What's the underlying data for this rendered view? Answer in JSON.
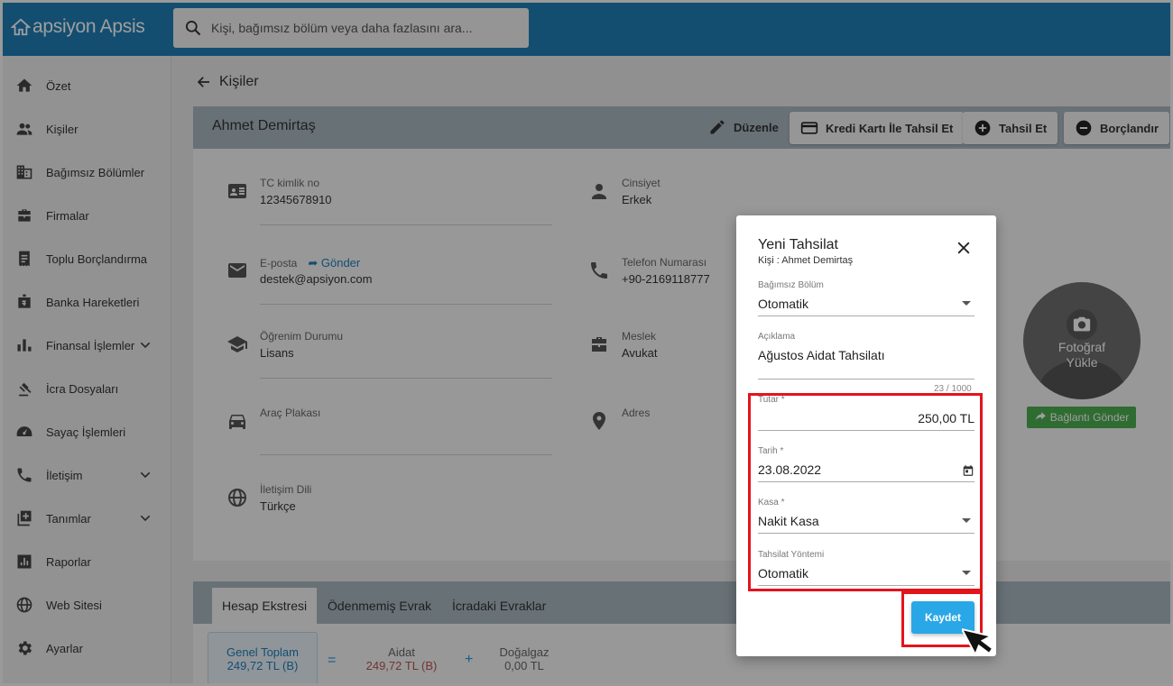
{
  "app": {
    "name": "apsiyon Apsis"
  },
  "search": {
    "placeholder": "Kişi, bağımsız bölüm veya daha fazlasını ara..."
  },
  "sidebar": {
    "items": [
      {
        "label": "Özet",
        "icon": "home-icon"
      },
      {
        "label": "Kişiler",
        "icon": "people-icon"
      },
      {
        "label": "Bağımsız Bölümler",
        "icon": "building-icon"
      },
      {
        "label": "Firmalar",
        "icon": "briefcase-icon"
      },
      {
        "label": "Toplu Borçlandırma",
        "icon": "receipt-icon"
      },
      {
        "label": "Banka Hareketleri",
        "icon": "bank-icon"
      },
      {
        "label": "Finansal İşlemler",
        "icon": "bar-chart-icon",
        "expandable": true
      },
      {
        "label": "İcra Dosyaları",
        "icon": "gavel-icon"
      },
      {
        "label": "Sayaç İşlemleri",
        "icon": "meter-icon"
      },
      {
        "label": "İletişim",
        "icon": "phone-icon",
        "expandable": true
      },
      {
        "label": "Tanımlar",
        "icon": "add-box-icon",
        "expandable": true
      },
      {
        "label": "Raporlar",
        "icon": "report-icon"
      },
      {
        "label": "Web Sitesi",
        "icon": "globe-icon"
      },
      {
        "label": "Ayarlar",
        "icon": "gear-icon"
      }
    ]
  },
  "page": {
    "back_label": "Kişiler"
  },
  "person": {
    "name": "Ahmet Demirtaş",
    "edit_label": "Düzenle",
    "actions": {
      "credit_card": "Kredi Kartı İle Tahsil Et",
      "collect": "Tahsil Et",
      "debit": "Borçlandır"
    },
    "fields": {
      "tc": {
        "label": "TC kimlik no",
        "value": "12345678910"
      },
      "gender": {
        "label": "Cinsiyet",
        "value": "Erkek"
      },
      "email": {
        "label": "E-posta",
        "send": "Gönder",
        "value": "destek@apsiyon.com"
      },
      "phone": {
        "label": "Telefon Numarası",
        "value": "+90-2169118777"
      },
      "education": {
        "label": "Öğrenim Durumu",
        "value": "Lisans"
      },
      "job": {
        "label": "Meslek",
        "value": "Avukat"
      },
      "plate": {
        "label": "Araç Plakası",
        "value": ""
      },
      "address": {
        "label": "Adres",
        "value": ""
      },
      "language": {
        "label": "İletişim Dili",
        "value": "Türkçe"
      }
    },
    "photo": {
      "upload_label_1": "Fotoğraf",
      "upload_label_2": "Yükle",
      "send_link": "Bağlantı Gönder"
    }
  },
  "account": {
    "tabs": [
      "Hesap Ekstresi",
      "Ödenmemiş Evrak",
      "İcradaki Evraklar"
    ],
    "summary": {
      "total_label": "Genel Toplam",
      "total_value": "249,72 TL (B)",
      "eq": "=",
      "dues_label": "Aidat",
      "dues_value": "249,72 TL (B)",
      "plus": "+",
      "gas_label": "Doğalgaz",
      "gas_value": "0,00 TL"
    }
  },
  "dialog": {
    "title": "Yeni Tahsilat",
    "subtitle": "Kişi : Ahmet Demirtaş",
    "unit": {
      "label": "Bağımsız Bölüm",
      "value": "Otomatik"
    },
    "description": {
      "label": "Açıklama",
      "value": "Ağustos Aidat Tahsilatı",
      "counter": "23 / 1000"
    },
    "amount": {
      "label": "Tutar *",
      "value": "250,00 TL"
    },
    "date": {
      "label": "Tarih *",
      "value": "23.08.2022"
    },
    "cashbox": {
      "label": "Kasa *",
      "value": "Nakit Kasa"
    },
    "method": {
      "label": "Tahsilat Yöntemi",
      "value": "Otomatik"
    },
    "save_label": "Kaydet"
  },
  "colors": {
    "topbar": "#1f7fb6",
    "accent": "#2aa7e6",
    "highlight": "#e4141b",
    "success": "#4caf50"
  }
}
